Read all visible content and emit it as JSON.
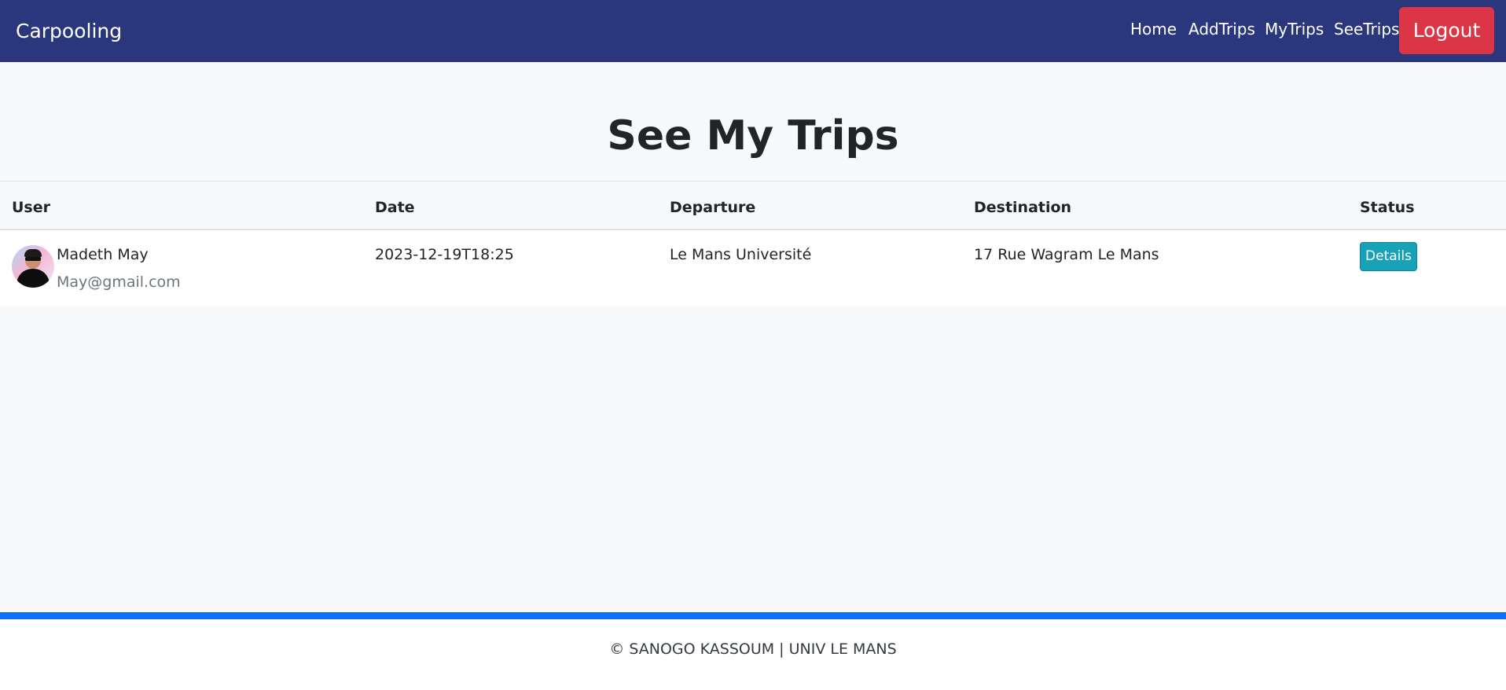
{
  "navbar": {
    "brand": "Carpooling",
    "links": [
      "Home",
      "AddTrips",
      "MyTrips",
      "SeeTrips"
    ],
    "logout_label": "Logout"
  },
  "page": {
    "title": "See My Trips"
  },
  "table": {
    "columns": [
      "User",
      "Date",
      "Departure",
      "Destination",
      "Status"
    ],
    "rows": [
      {
        "user_name": "Madeth May",
        "user_email": "May@gmail.com",
        "date": "2023-12-19T18:25",
        "departure": "Le Mans Université",
        "destination": "17 Rue Wagram Le Mans",
        "status_button": "Details"
      }
    ]
  },
  "footer": {
    "text": "© SANOGO KASSOUM | UNIV LE MANS"
  },
  "colors": {
    "navbar": "#2b377c",
    "logout": "#dc3545",
    "details": "#17a2b8",
    "footer_accent": "#0d6efd"
  }
}
